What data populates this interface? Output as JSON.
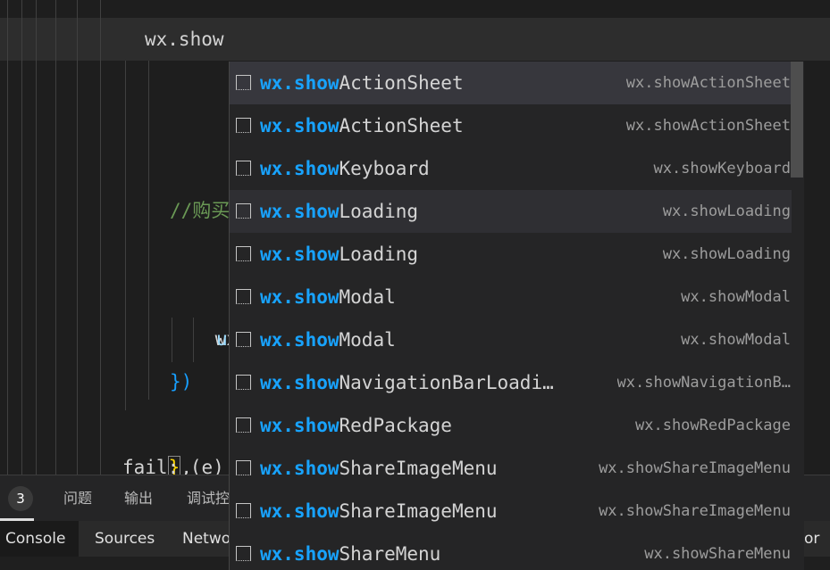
{
  "editor": {
    "current_line": "wx.show",
    "comment": "//购买",
    "method_prefix": "wx.re",
    "inner_fragment": "u",
    "close_paren": "})",
    "close_brace": "}",
    "brace_comma": ",",
    "fail_fragment": "fail: (e)"
  },
  "suggestions": {
    "query": "wx.show",
    "items": [
      {
        "match": "wx.show",
        "rest": "ActionSheet",
        "detail": "wx.showActionSheet"
      },
      {
        "match": "wx.show",
        "rest": "ActionSheet",
        "detail": "wx.showActionSheet"
      },
      {
        "match": "wx.show",
        "rest": "Keyboard",
        "detail": "wx.showKeyboard"
      },
      {
        "match": "wx.show",
        "rest": "Loading",
        "detail": "wx.showLoading"
      },
      {
        "match": "wx.show",
        "rest": "Loading",
        "detail": "wx.showLoading"
      },
      {
        "match": "wx.show",
        "rest": "Modal",
        "detail": "wx.showModal"
      },
      {
        "match": "wx.show",
        "rest": "Modal",
        "detail": "wx.showModal"
      },
      {
        "match": "wx.show",
        "rest": "NavigationBarLoadi…",
        "detail": "wx.showNavigationB…"
      },
      {
        "match": "wx.show",
        "rest": "RedPackage",
        "detail": "wx.showRedPackage"
      },
      {
        "match": "wx.show",
        "rest": "ShareImageMenu",
        "detail": "wx.showShareImageMenu"
      },
      {
        "match": "wx.show",
        "rest": "ShareImageMenu",
        "detail": "wx.showShareImageMenu"
      },
      {
        "match": "wx.show",
        "rest": "ShareMenu",
        "detail": "wx.showShareMenu"
      }
    ]
  },
  "panel": {
    "badge_count": "3",
    "tabs": [
      "问题",
      "输出",
      "调试控"
    ]
  },
  "devtools": {
    "tabs": [
      "Console",
      "Sources",
      "Netwo"
    ],
    "tail": "or"
  }
}
